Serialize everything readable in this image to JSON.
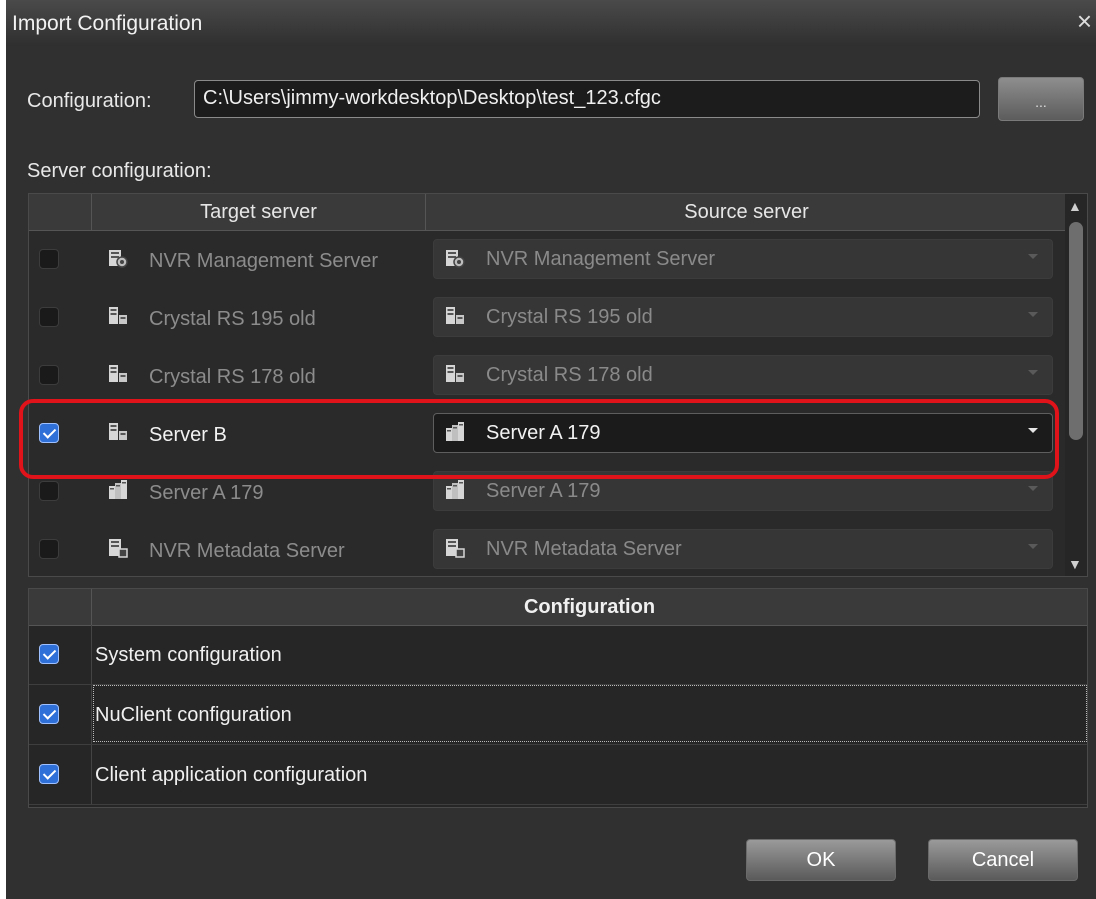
{
  "window": {
    "title": "Import Configuration",
    "close_glyph": "×"
  },
  "configuration": {
    "label": "Configuration:",
    "path": "C:\\Users\\jimmy-workdesktop\\Desktop\\test_123.cfgc",
    "browse_label": "..."
  },
  "server_configuration": {
    "label": "Server configuration:",
    "columns": [
      "Target server",
      "Source server"
    ],
    "rows": [
      {
        "checked": false,
        "target": "NVR Management Server",
        "target_icon": "management-server-icon",
        "source": "NVR Management Server",
        "source_icon": "management-server-icon",
        "enabled": false
      },
      {
        "checked": false,
        "target": "Crystal RS 195 old",
        "target_icon": "recording-server-icon",
        "source": "Crystal RS 195 old",
        "source_icon": "recording-server-icon",
        "enabled": false
      },
      {
        "checked": false,
        "target": "Crystal RS 178 old",
        "target_icon": "recording-server-icon",
        "source": "Crystal RS 178 old",
        "source_icon": "recording-server-icon",
        "enabled": false
      },
      {
        "checked": true,
        "target": "Server B",
        "target_icon": "recording-server-icon",
        "source": "Server A 179",
        "source_icon": "server-group-icon",
        "enabled": true
      },
      {
        "checked": false,
        "target": "Server A 179",
        "target_icon": "server-group-icon",
        "source": "Server A 179",
        "source_icon": "server-group-icon",
        "enabled": false
      },
      {
        "checked": false,
        "target": "NVR Metadata Server",
        "target_icon": "metadata-server-icon",
        "source": "NVR Metadata Server",
        "source_icon": "metadata-server-icon",
        "enabled": false
      }
    ]
  },
  "config_table": {
    "header": "Configuration",
    "items": [
      {
        "checked": true,
        "label": "System configuration"
      },
      {
        "checked": true,
        "label": "NuClient configuration",
        "focused": true
      },
      {
        "checked": true,
        "label": "Client application configuration"
      }
    ]
  },
  "buttons": {
    "ok": "OK",
    "cancel": "Cancel"
  },
  "colors": {
    "background": "#303030",
    "checkbox_checked": "#2f6fd8",
    "highlight": "#e0121a"
  }
}
